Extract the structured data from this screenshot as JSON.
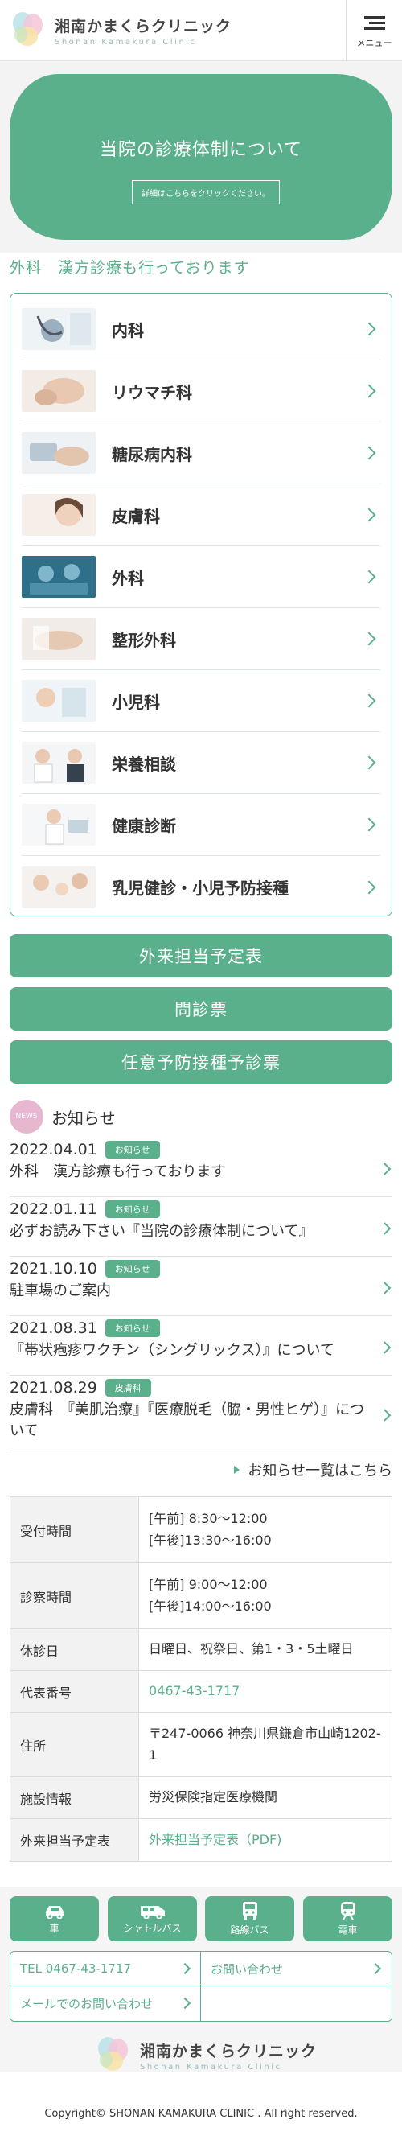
{
  "header": {
    "logo_jp": "湘南かまくらクリニック",
    "logo_en": "Shonan Kamakura Clinic",
    "menu_label": "メニュー"
  },
  "hero": {
    "title": "当院の診療体制について",
    "button_label": "詳細はこちらをクリックください。"
  },
  "headline": "外科　漢方診療も行っております",
  "departments": [
    {
      "label": "内科"
    },
    {
      "label": "リウマチ科"
    },
    {
      "label": "糖尿病内科"
    },
    {
      "label": "皮膚科"
    },
    {
      "label": "外科"
    },
    {
      "label": "整形外科"
    },
    {
      "label": "小児科"
    },
    {
      "label": "栄養相談"
    },
    {
      "label": "健康診断"
    },
    {
      "label": "乳児健診・小児予防接種"
    }
  ],
  "buttons": {
    "schedule": "外来担当予定表",
    "questionnaire": "問診票",
    "vaccine": "任意予防接種予診票"
  },
  "news": {
    "icon_label": "NEWS",
    "title": "お知らせ",
    "items": [
      {
        "date": "2022.04.01",
        "badge": "お知らせ",
        "text": "外科　漢方診療も行っております"
      },
      {
        "date": "2022.01.11",
        "badge": "お知らせ",
        "text": "必ずお読み下さい『当院の診療体制について』"
      },
      {
        "date": "2021.10.10",
        "badge": "お知らせ",
        "text": "駐車場のご案内"
      },
      {
        "date": "2021.08.31",
        "badge": "お知らせ",
        "text": "『帯状疱疹ワクチン（シングリックス）』について"
      },
      {
        "date": "2021.08.29",
        "badge": "皮膚科",
        "text": "皮膚科　『美肌治療』『医療脱毛（脇・男性ヒゲ）』について"
      }
    ],
    "all_link": "お知らせ一覧はこちら"
  },
  "info": {
    "rows": [
      {
        "label": "受付時間",
        "lines": [
          "[午前] 8:30〜12:00",
          "[午後]13:30〜16:00"
        ]
      },
      {
        "label": "診察時間",
        "lines": [
          "[午前] 9:00〜12:00",
          "[午後]14:00〜16:00"
        ]
      },
      {
        "label": "休診日",
        "lines": [
          "日曜日、祝祭日、第1・3・5土曜日"
        ]
      },
      {
        "label": "代表番号",
        "lines": [
          "0467-43-1717"
        ]
      },
      {
        "label": "住所",
        "lines": [
          "〒247-0066 神奈川県鎌倉市山崎1202-1"
        ]
      },
      {
        "label": "施設情報",
        "lines": [
          "労災保険指定医療機関"
        ]
      },
      {
        "label": "外来担当予定表",
        "lines": [
          "外来担当予定表（PDF)"
        ]
      }
    ]
  },
  "access": {
    "car": "車",
    "shuttle": "シャトルバス",
    "bus": "路線バス",
    "train": "電車"
  },
  "contact": {
    "tel": "TEL 0467-43-1717",
    "inquiry": "お問い合わせ",
    "mail": "メールでのお問い合わせ"
  },
  "footer": {
    "logo_jp": "湘南かまくらクリニック",
    "logo_en": "Shonan Kamakura Clinic",
    "copyright": "Copyright© SHONAN KAMAKURA CLINIC . All right reserved."
  },
  "colors": {
    "accent": "#5bb08c",
    "news_icon": "#e7b6cf"
  }
}
